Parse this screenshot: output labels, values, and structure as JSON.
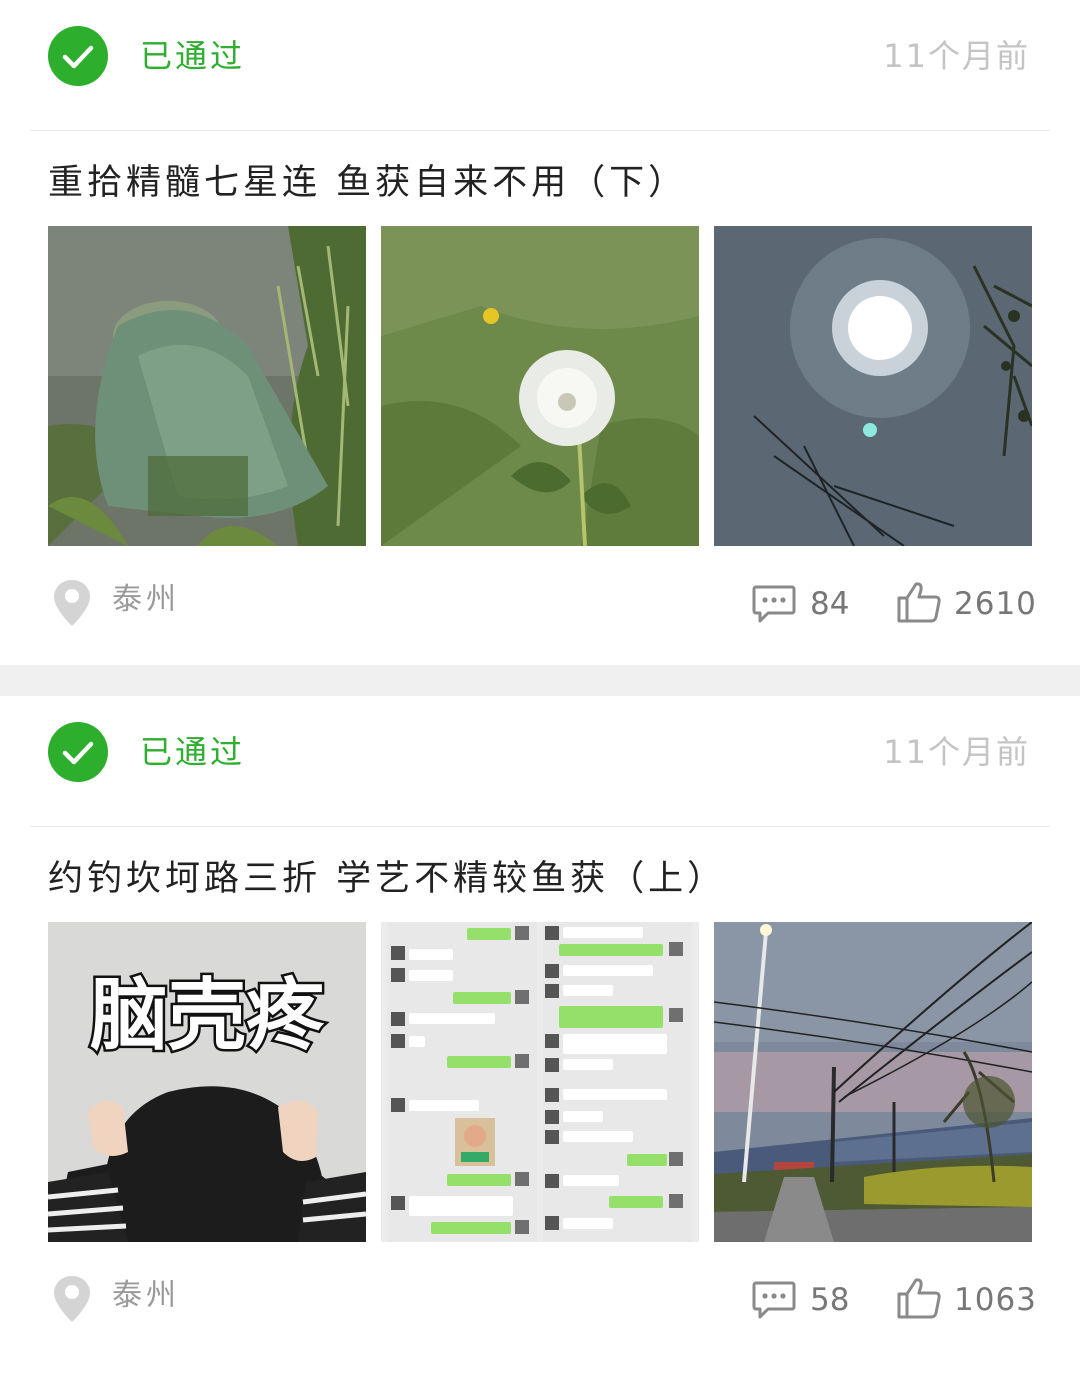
{
  "posts": [
    {
      "status": "已通过",
      "time": "11个月前",
      "title": "重拾精髓七星连  鱼获自来不用（下）",
      "images": [
        "fish-net-in-water-photo",
        "dandelion-photo",
        "sun-in-sky-photo"
      ],
      "location": "泰州",
      "comments": "84",
      "likes": "2610"
    },
    {
      "status": "已通过",
      "time": "11个月前",
      "title": "约钓坎坷路三折  学艺不精较鱼获（上）",
      "images": [
        "headache-meme-image",
        "chat-screenshot-image",
        "roadside-power-lines-photo"
      ],
      "meme_text": "脑壳疼",
      "location": "泰州",
      "comments": "58",
      "likes": "1063"
    }
  ],
  "colors": {
    "accent_green": "#2dae2d",
    "time_gray": "#c4c4c4",
    "meta_gray": "#9a9a9a"
  },
  "icons": [
    "check-circle-icon",
    "location-pin-icon",
    "comment-icon",
    "thumbs-up-icon"
  ]
}
